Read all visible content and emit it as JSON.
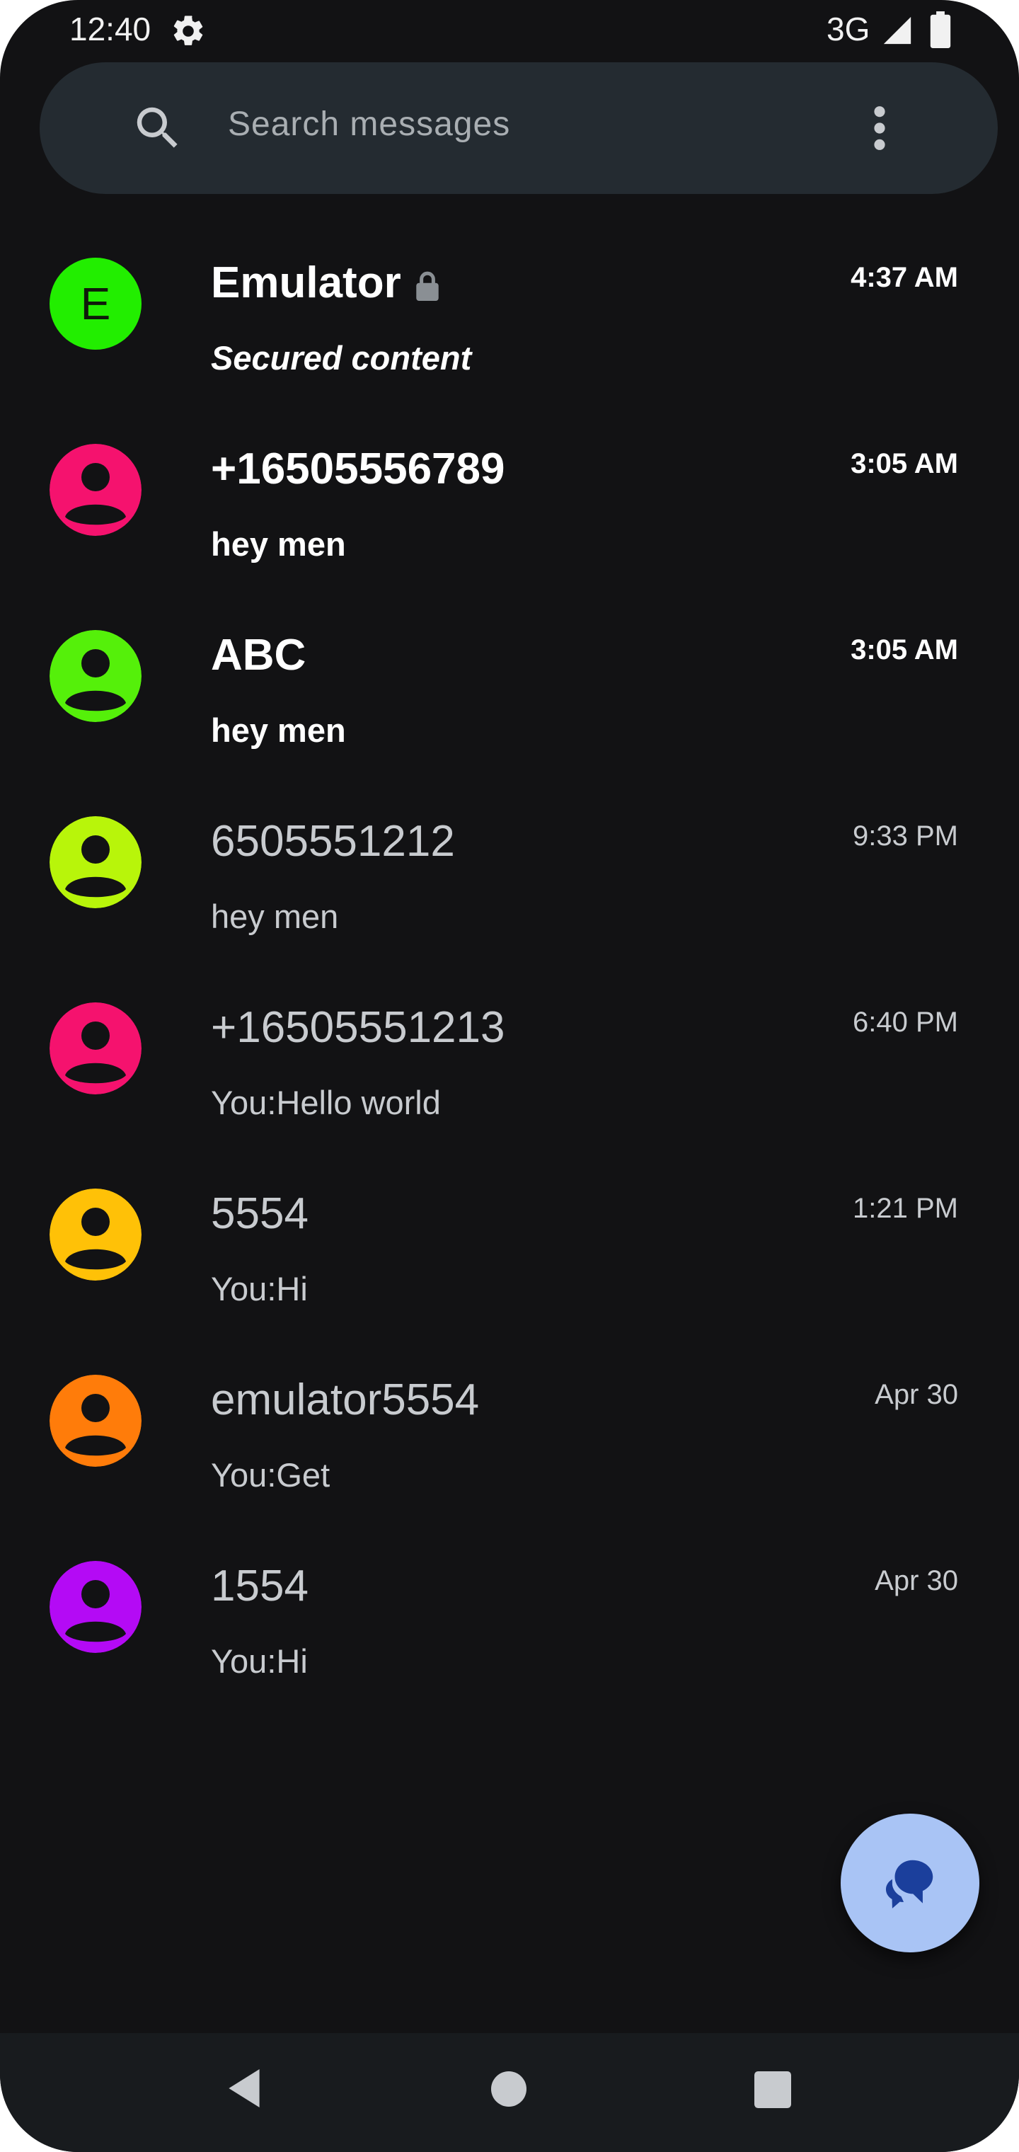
{
  "status_bar": {
    "time": "12:40",
    "network": "3G",
    "icons": [
      "settings-icon",
      "signal-icon",
      "battery-icon"
    ]
  },
  "search": {
    "placeholder": "Search messages",
    "icons": [
      "search-icon",
      "more-vert-icon"
    ]
  },
  "conversations": [
    {
      "name": "Emulator",
      "preview": "Secured content",
      "time": "4:37 AM",
      "unread": true,
      "avatar_letter": "E",
      "avatar_color": "#22ee00",
      "locked": true
    },
    {
      "name": "+16505556789",
      "preview": "hey men",
      "time": "3:05 AM",
      "unread": true,
      "avatar_color": "#f5126e"
    },
    {
      "name": "ABC",
      "preview": "hey men",
      "time": "3:05 AM",
      "unread": true,
      "avatar_color": "#55f00a"
    },
    {
      "name": "6505551212",
      "preview": "hey men",
      "time": "9:33 PM",
      "unread": false,
      "avatar_color": "#b8f50a"
    },
    {
      "name": "+16505551213",
      "preview": "You:Hello world",
      "time": "6:40 PM",
      "unread": false,
      "avatar_color": "#f5126e"
    },
    {
      "name": "5554",
      "preview": "You:Hi",
      "time": "1:21 PM",
      "unread": false,
      "avatar_color": "#ffc107"
    },
    {
      "name": "emulator5554",
      "preview": "You:Get",
      "time": "Apr 30",
      "unread": false,
      "avatar_color": "#ff7c0a"
    },
    {
      "name": "1554",
      "preview": "You:Hi",
      "time": "Apr 30",
      "unread": false,
      "avatar_color": "#b40af5"
    }
  ],
  "fab": {
    "icon": "start-chat-icon",
    "color": "#a9c4f5"
  },
  "nav_bar": {
    "icons": [
      "back-icon",
      "home-icon",
      "recents-icon"
    ]
  },
  "colors": {
    "background": "#121214",
    "search_bar": "#242b31",
    "unread_text": "#ffffff",
    "read_text": "#c8cbcf"
  }
}
